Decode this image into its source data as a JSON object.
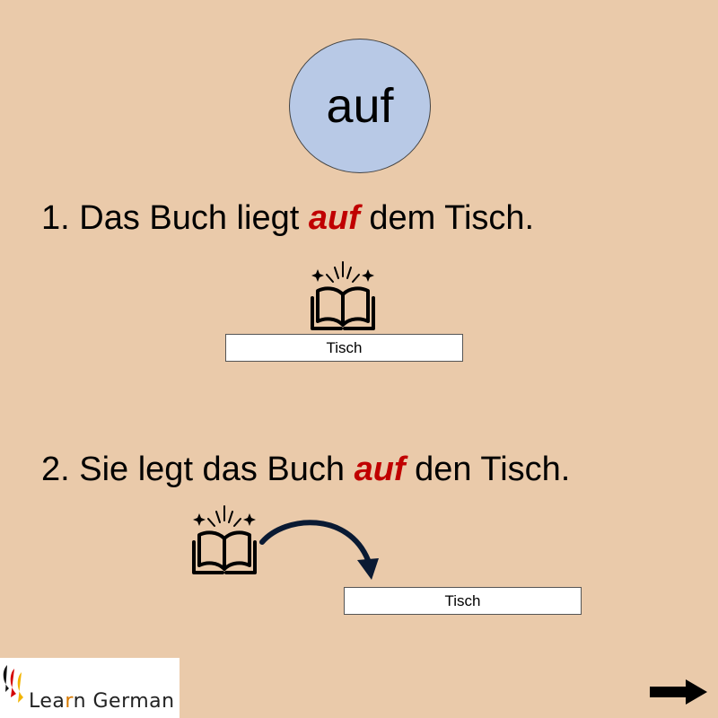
{
  "title_word": "auf",
  "sentence1": {
    "prefix": "1. Das Buch liegt ",
    "accent": "auf",
    "suffix": " dem Tisch."
  },
  "sentence2": {
    "prefix": "2. Sie legt das Buch ",
    "accent": "auf",
    "suffix": " den Tisch."
  },
  "table1_label": "Tisch",
  "table2_label": "Tisch",
  "logo": {
    "part1": "Lea",
    "part2": "r",
    "part3": "n German"
  },
  "colors": {
    "background": "#eacaaa",
    "circle": "#b8c9e6",
    "accent": "#c00000"
  },
  "icons": [
    "book-icon",
    "curved-arrow-icon",
    "right-arrow-icon",
    "flag-pin-icon"
  ]
}
